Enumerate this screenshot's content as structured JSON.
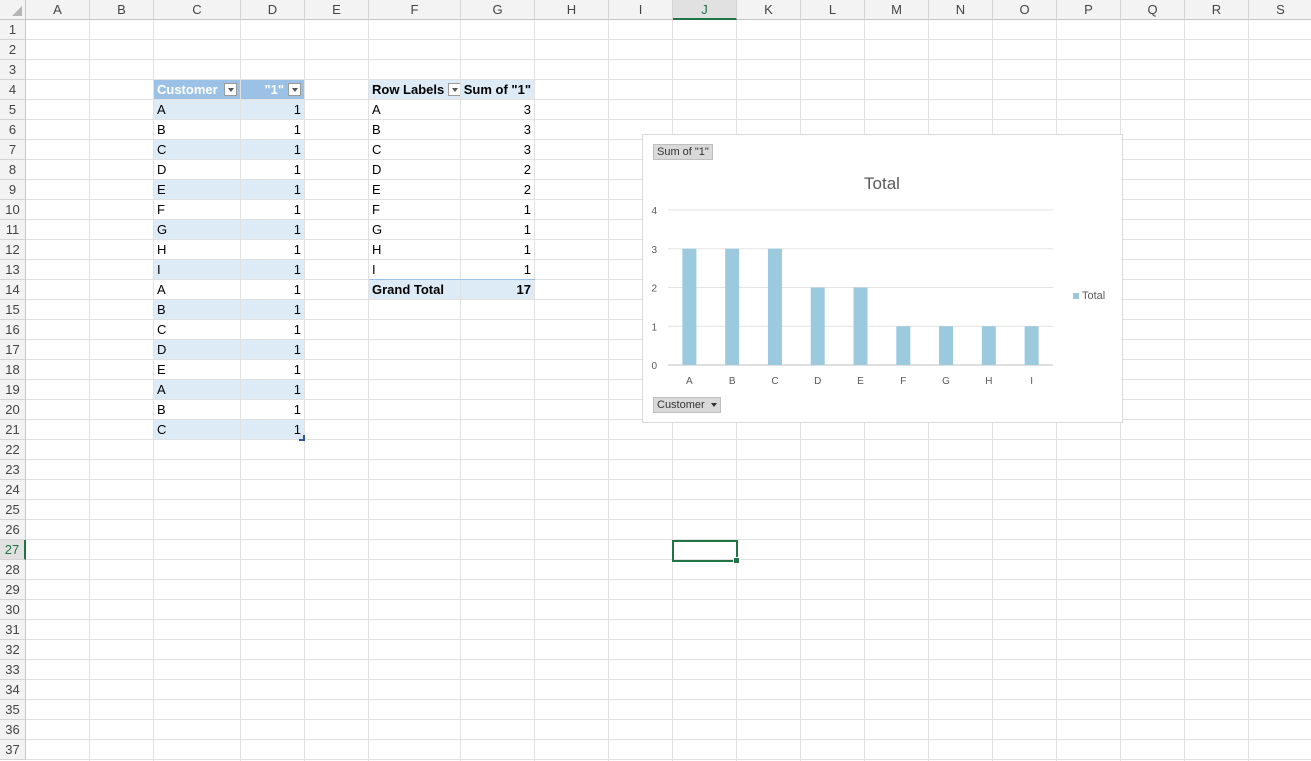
{
  "columns": [
    "A",
    "B",
    "C",
    "D",
    "E",
    "F",
    "G",
    "H",
    "I",
    "J",
    "K",
    "L",
    "M",
    "N",
    "O",
    "P",
    "Q",
    "R",
    "S"
  ],
  "rows": [
    "1",
    "2",
    "3",
    "4",
    "5",
    "6",
    "7",
    "8",
    "9",
    "10",
    "11",
    "12",
    "13",
    "14",
    "15",
    "16",
    "17",
    "18",
    "19",
    "20",
    "21",
    "22",
    "23",
    "24",
    "25",
    "26",
    "27",
    "28",
    "29",
    "30",
    "31",
    "32",
    "33",
    "34",
    "35",
    "36",
    "37"
  ],
  "selected_cell": "J27",
  "table": {
    "headers": [
      "Customer",
      "\"1\""
    ],
    "rows": [
      [
        "A",
        "1"
      ],
      [
        "B",
        "1"
      ],
      [
        "C",
        "1"
      ],
      [
        "D",
        "1"
      ],
      [
        "E",
        "1"
      ],
      [
        "F",
        "1"
      ],
      [
        "G",
        "1"
      ],
      [
        "H",
        "1"
      ],
      [
        "I",
        "1"
      ],
      [
        "A",
        "1"
      ],
      [
        "B",
        "1"
      ],
      [
        "C",
        "1"
      ],
      [
        "D",
        "1"
      ],
      [
        "E",
        "1"
      ],
      [
        "A",
        "1"
      ],
      [
        "B",
        "1"
      ],
      [
        "C",
        "1"
      ]
    ]
  },
  "pivot": {
    "header_labels": "Row Labels",
    "header_sum": "Sum of \"1\"",
    "rows": [
      [
        "A",
        "3"
      ],
      [
        "B",
        "3"
      ],
      [
        "C",
        "3"
      ],
      [
        "D",
        "2"
      ],
      [
        "E",
        "2"
      ],
      [
        "F",
        "1"
      ],
      [
        "G",
        "1"
      ],
      [
        "H",
        "1"
      ],
      [
        "I",
        "1"
      ]
    ],
    "total_label": "Grand Total",
    "total_value": "17"
  },
  "chart": {
    "value_button": "Sum of \"1\"",
    "axis_button": "Customer",
    "bar_color": "#9bc9de"
  },
  "chart_data": {
    "type": "bar",
    "title": "Total",
    "categories": [
      "A",
      "B",
      "C",
      "D",
      "E",
      "F",
      "G",
      "H",
      "I"
    ],
    "series": [
      {
        "name": "Total",
        "values": [
          3,
          3,
          3,
          2,
          2,
          1,
          1,
          1,
          1
        ]
      }
    ],
    "ylim": [
      0,
      4
    ],
    "yticks": [
      "0",
      "1",
      "2",
      "3",
      "4"
    ],
    "grid": true,
    "legend": "right"
  }
}
